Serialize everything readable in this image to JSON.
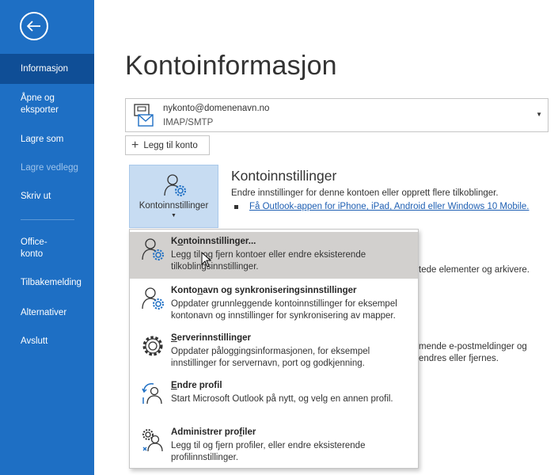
{
  "sidebar": {
    "items": [
      {
        "label": "Informasjon",
        "active": true
      },
      {
        "label": "Åpne og eksporter"
      },
      {
        "label": "Lagre som"
      },
      {
        "label": "Lagre vedlegg",
        "disabled": true
      },
      {
        "label": "Skriv ut"
      },
      {
        "label": "Office-konto"
      },
      {
        "label": "Tilbakemelding"
      },
      {
        "label": "Alternativer"
      },
      {
        "label": "Avslutt"
      }
    ]
  },
  "main": {
    "title": "Kontoinformasjon",
    "account": {
      "email": "nykonto@domenenavn.no",
      "type": "IMAP/SMTP"
    },
    "add_account_label": "Legg til konto",
    "settings_button": {
      "label": "Kontoinnstillinger"
    },
    "section": {
      "title": "Kontoinnstillinger",
      "description": "Endre innstillinger for denne kontoen eller opprett flere tilkoblinger.",
      "link": "Få Outlook-appen for iPhone, iPad, Android eller Windows 10 Mobile."
    },
    "behind_texts": [
      "tede elementer og arkivere.",
      "mende e-postmeldinger og",
      "endres eller fjernes."
    ]
  },
  "menu": {
    "items": [
      {
        "title_pre": "K",
        "title_ul": "o",
        "title_post": "ntoinnstillinger...",
        "desc_1": "Legg til og fjern kontoer eller endre eksisterende",
        "desc_2": "tilkoblingsinnstillinger.",
        "icon": "person-gear-icon"
      },
      {
        "title_pre": "Konto",
        "title_ul": "n",
        "title_post": "avn og synkroniseringsinnstillinger",
        "desc_1": "Oppdater grunnleggende kontoinnstillinger for eksempel",
        "desc_2": "kontonavn og innstillinger for synkronisering av mapper.",
        "icon": "person-sync-gear-icon"
      },
      {
        "title_pre": "",
        "title_ul": "S",
        "title_post": "erverinnstillinger",
        "desc_1": "Oppdater påloggingsinformasjonen, for eksempel",
        "desc_2": "innstillinger for servernavn, port og godkjenning.",
        "icon": "gear-icon"
      },
      {
        "title_pre": "",
        "title_ul": "E",
        "title_post": "ndre profil",
        "desc_1": "Start Microsoft Outlook på nytt, og velg en annen profil.",
        "desc_2": "",
        "icon": "switch-profile-icon"
      },
      {
        "title_pre": "Administrer pro",
        "title_ul": "f",
        "title_post": "iler",
        "desc_1": "Legg til og fjern profiler, eller endre eksisterende",
        "desc_2": "profilinnstillinger.",
        "icon": "manage-profiles-icon"
      }
    ]
  },
  "colors": {
    "sidebar_bg": "#1e6fc4",
    "sidebar_active": "#0f4e96",
    "link": "#1e5fb3",
    "menu_hover": "#d2d0ce",
    "button_bg": "#c7dcf2",
    "icon_blue": "#2f7ed8"
  }
}
